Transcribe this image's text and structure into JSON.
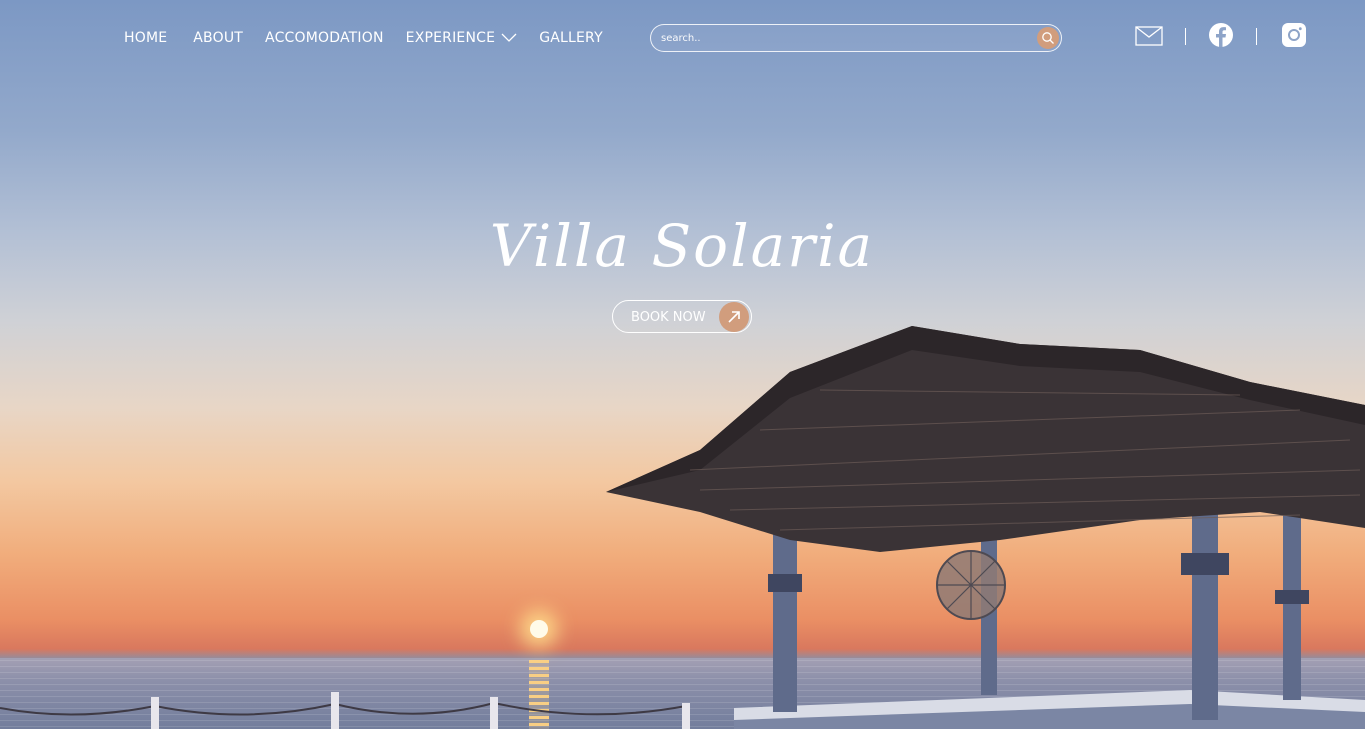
{
  "nav": {
    "items": [
      {
        "label": "HOME"
      },
      {
        "label": "ABOUT"
      },
      {
        "label": "ACCOMODATION"
      },
      {
        "label": "EXPERIENCE",
        "has_dropdown": true
      },
      {
        "label": "GALLERY"
      }
    ]
  },
  "search": {
    "placeholder": "search.."
  },
  "social": {
    "icons": [
      "mail-icon",
      "facebook-icon",
      "instagram-icon"
    ]
  },
  "hero": {
    "title": "Villa Solaria",
    "cta_label": "BOOK NOW"
  },
  "colors": {
    "accent": "#d19d7d",
    "text": "#ffffff"
  }
}
